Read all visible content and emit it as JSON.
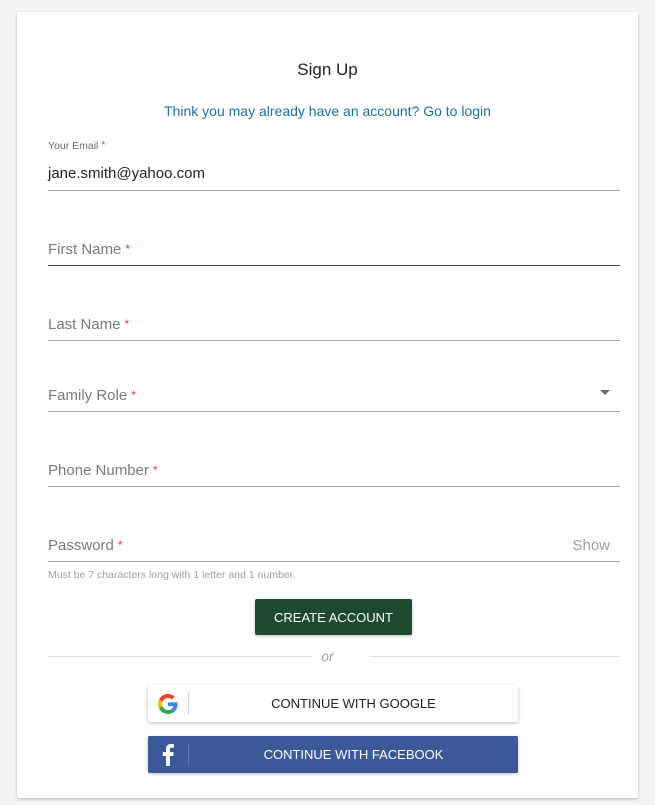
{
  "form": {
    "title": "Sign Up",
    "login_link": "Think you may already have an account? Go to login",
    "required_marker": "*",
    "email": {
      "label": "Your Email",
      "value": "jane.smith@yahoo.com"
    },
    "first_name": {
      "label": "First Name"
    },
    "last_name": {
      "label": "Last Name"
    },
    "family_role": {
      "label": "Family Role"
    },
    "phone": {
      "label": "Phone Number"
    },
    "password": {
      "label": "Password",
      "show_label": "Show",
      "hint": "Must be 7 characters long with 1 letter and 1 number."
    },
    "create_button": "CREATE ACCOUNT",
    "divider_text": "or",
    "google_button": "CONTINUE WITH GOOGLE",
    "facebook_button": "CONTINUE WITH FACEBOOK"
  },
  "colors": {
    "primary_button": "#1e4a30",
    "link": "#1d6fa5",
    "required": "#e53935",
    "facebook": "#3b5998"
  },
  "icons": {
    "dropdown": "chevron-down-icon",
    "google": "google-icon",
    "facebook": "facebook-icon"
  }
}
